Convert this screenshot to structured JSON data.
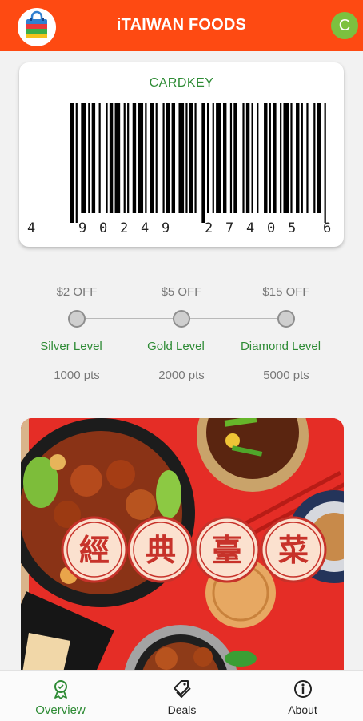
{
  "header": {
    "title": "iTAIWAN FOODS",
    "avatar_letter": "C",
    "logo_icon": "shopping-bag-icon"
  },
  "card": {
    "label": "CARDKEY",
    "barcode_digits": [
      "4",
      "9",
      "0",
      "2",
      "4",
      "9",
      "2",
      "7",
      "4",
      "0",
      "5",
      "6"
    ]
  },
  "levels": [
    {
      "discount": "$2 OFF",
      "name": "Silver Level",
      "points": "1000 pts"
    },
    {
      "discount": "$5 OFF",
      "name": "Gold Level",
      "points": "2000 pts"
    },
    {
      "discount": "$15 OFF",
      "name": "Diamond Level",
      "points": "5000 pts"
    }
  ],
  "promo": {
    "characters": [
      "經",
      "典",
      "臺",
      "菜"
    ]
  },
  "nav": {
    "items": [
      {
        "label": "Overview",
        "icon": "medal-icon",
        "active": true
      },
      {
        "label": "Deals",
        "icon": "tags-icon",
        "active": false
      },
      {
        "label": "About",
        "icon": "info-icon",
        "active": false
      }
    ]
  },
  "colors": {
    "header": "#fe4a12",
    "accent_green": "#2e8b35",
    "promo_red": "#e52d26",
    "avatar": "#7cc13f"
  }
}
